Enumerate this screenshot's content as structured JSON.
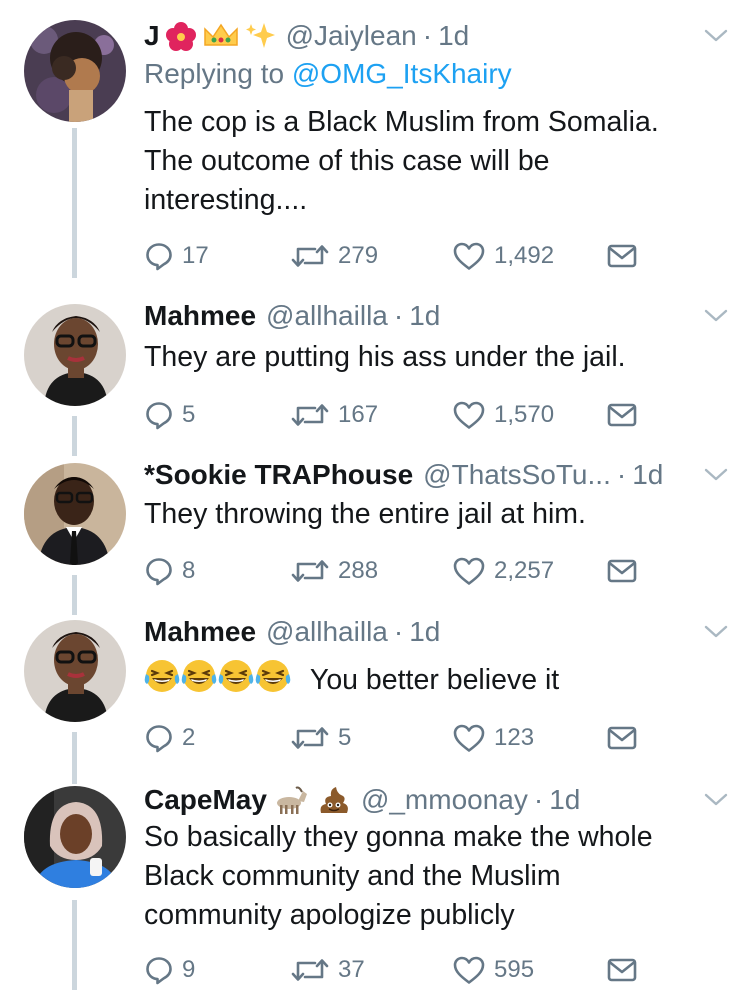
{
  "colors": {
    "text": "#14171a",
    "muted": "#657786",
    "link": "#1da1f2",
    "thread": "#ccd6dd"
  },
  "tweets": [
    {
      "name": "J",
      "name_emoji": [
        "hibiscus",
        "crown",
        "sparkles"
      ],
      "handle": "@Jaiylean",
      "time": "1d",
      "reply_label": "Replying to",
      "reply_handle": "@OMG_ItsKhairy",
      "text_lines": [
        "The cop is a Black Muslim from Somalia.",
        "The outcome of this case will be",
        "interesting...."
      ],
      "replies": "17",
      "retweets": "279",
      "likes": "1,492"
    },
    {
      "name": "Mahmee",
      "handle": "@allhailla",
      "time": "1d",
      "text_lines": [
        "They are putting his ass under the jail."
      ],
      "replies": "5",
      "retweets": "167",
      "likes": "1,570"
    },
    {
      "name": "*Sookie TRAPhouse",
      "handle": "@ThatsSoTu...",
      "time": "1d",
      "text_lines": [
        "They throwing the entire jail at him."
      ],
      "replies": "8",
      "retweets": "288",
      "likes": "2,257"
    },
    {
      "name": "Mahmee",
      "handle": "@allhailla",
      "time": "1d",
      "emoji_prefix": [
        "tears-of-joy",
        "tears-of-joy",
        "tears-of-joy",
        "tears-of-joy"
      ],
      "text_lines": [
        "You better believe it"
      ],
      "replies": "2",
      "retweets": "5",
      "likes": "123"
    },
    {
      "name": "CapeMay",
      "name_emoji": [
        "goat",
        "pile-of-poo"
      ],
      "handle": "@_mmoonay",
      "time": "1d",
      "text_lines": [
        "So basically they gonna make the whole",
        "Black community and the Muslim",
        "community apologize publicly"
      ],
      "replies": "9",
      "retweets": "37",
      "likes": "595"
    }
  ]
}
